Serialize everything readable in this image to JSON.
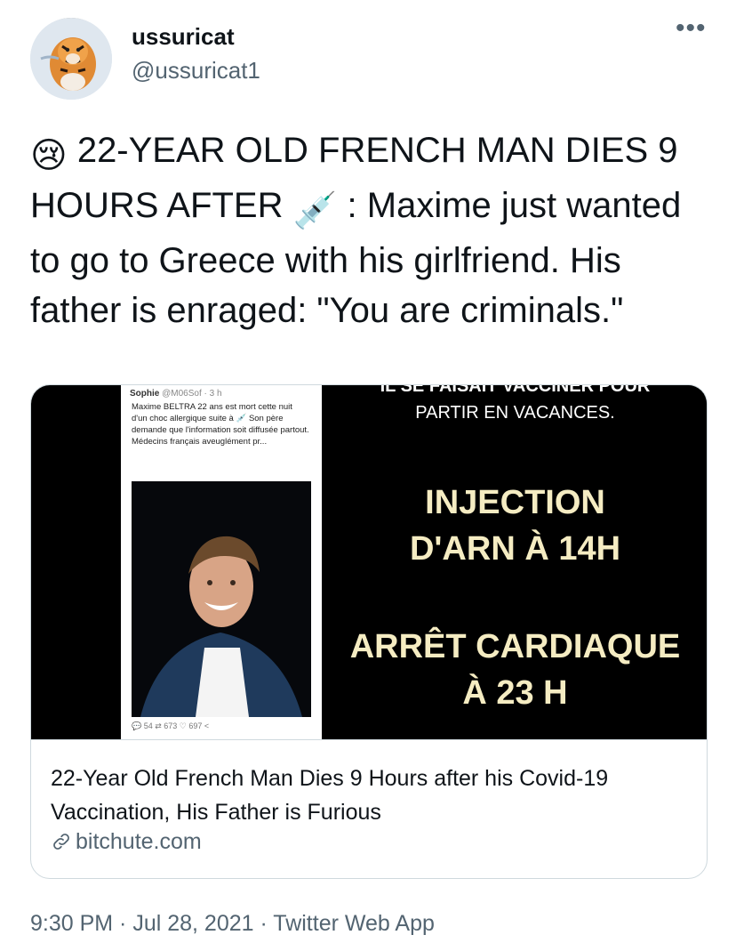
{
  "user": {
    "display_name": "ussuricat",
    "handle": "@ussuricat1"
  },
  "more_icon": "more-icon",
  "tweet": {
    "emoji_sad": "😢",
    "part1": " 22-YEAR OLD FRENCH MAN DIES 9 HOURS AFTER ",
    "emoji_syringe": "💉",
    "part2": " : Maxime just wanted to go to Greece with his girlfriend. His father is enraged: \"You are criminals.\""
  },
  "card": {
    "image": {
      "screenshot": {
        "author": "Sophie",
        "author_meta": "@M06Sof · 3 h",
        "text": "Maxime BELTRA 22 ans est mort cette nuit d'un choc allergique suite à 💉 Son père demande que l'information soit diffusée partout. Médecins français aveuglément pr...",
        "actions": "💬 54    ⇄ 673    ♡ 697    <"
      },
      "top_cut_text": "IL SE FAISAIT VACCINER POUR",
      "line_vacances": "PARTIR EN VACANCES.",
      "injection_1": "INJECTION",
      "injection_2": "D'ARN À 14H",
      "arret_1": "ARRÊT CARDIAQUE",
      "arret_2": "À 23 H"
    },
    "title": "22-Year Old French Man Dies 9 Hours after his Covid-19 Vaccination, His Father is Furious",
    "domain": "bitchute.com"
  },
  "footer": {
    "timestamp": "9:30 PM · Jul 28, 2021 · Twitter Web App"
  }
}
